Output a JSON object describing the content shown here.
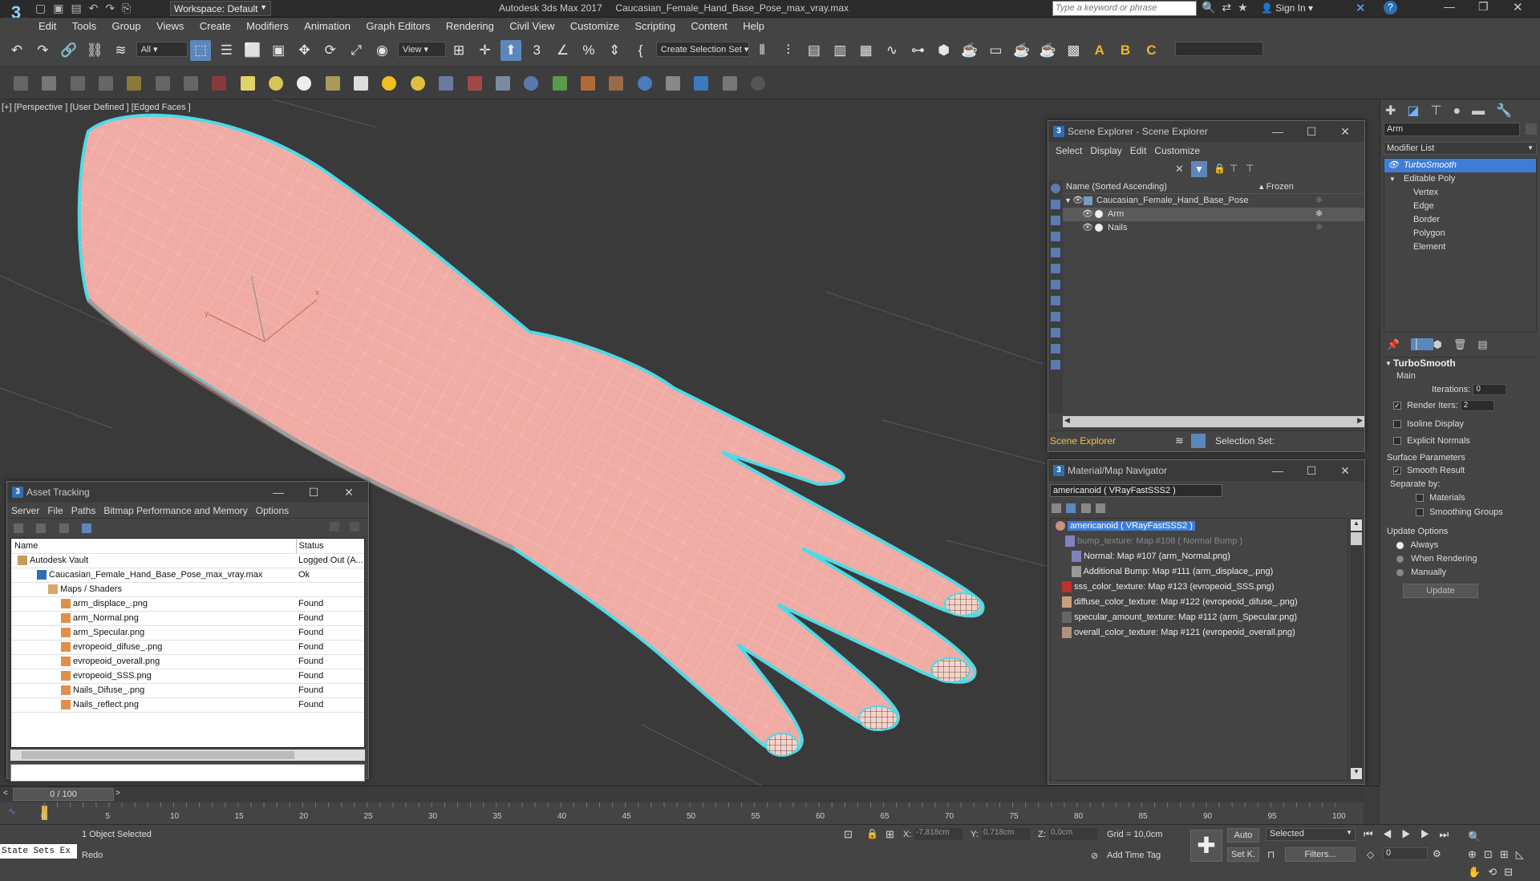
{
  "titlebar": {
    "workspace_label": "Workspace: Default",
    "app_title": "Autodesk 3ds Max 2017",
    "file_title": "Caucasian_Female_Hand_Base_Pose_max_vray.max",
    "search_placeholder": "Type a keyword or phrase",
    "sign_in": "Sign In"
  },
  "menubar": [
    "Edit",
    "Tools",
    "Group",
    "Views",
    "Create",
    "Modifiers",
    "Animation",
    "Graph Editors",
    "Rendering",
    "Civil View",
    "Customize",
    "Scripting",
    "Content",
    "Help"
  ],
  "toolbar": {
    "filter_value": "All",
    "refcoord_value": "View",
    "selection_set": "Create Selection Set"
  },
  "viewport": {
    "label_plus": "[+]",
    "label_view": "[Perspective ]",
    "label_shading": "[User Defined ]",
    "label_edges": "[Edged Faces ]",
    "gizmo_x": "x",
    "gizmo_y": "y",
    "gizmo_z": "z"
  },
  "asset_tracking": {
    "title": "Asset Tracking",
    "menu": [
      "Server",
      "File",
      "Paths",
      "Bitmap Performance and Memory",
      "Options"
    ],
    "col_name": "Name",
    "col_status": "Status",
    "rows": [
      {
        "name": "Autodesk Vault",
        "status": "Logged Out (A...",
        "indent": 0
      },
      {
        "name": "Caucasian_Female_Hand_Base_Pose_max_vray.max",
        "status": "Ok",
        "indent": 1
      },
      {
        "name": "Maps / Shaders",
        "status": "",
        "indent": 2
      },
      {
        "name": "arm_displace_.png",
        "status": "Found",
        "indent": 3
      },
      {
        "name": "arm_Normal.png",
        "status": "Found",
        "indent": 3
      },
      {
        "name": "arm_Specular.png",
        "status": "Found",
        "indent": 3
      },
      {
        "name": "evropeoid_difuse_.png",
        "status": "Found",
        "indent": 3
      },
      {
        "name": "evropeoid_overall.png",
        "status": "Found",
        "indent": 3
      },
      {
        "name": "evropeoid_SSS.png",
        "status": "Found",
        "indent": 3
      },
      {
        "name": "Nails_Difuse_.png",
        "status": "Found",
        "indent": 3
      },
      {
        "name": "Nails_reflect.png",
        "status": "Found",
        "indent": 3
      }
    ]
  },
  "scene_explorer": {
    "title": "Scene Explorer - Scene Explorer",
    "menu": [
      "Select",
      "Display",
      "Edit",
      "Customize"
    ],
    "col_name": "Name (Sorted Ascending)",
    "col_frozen": "▴ Frozen",
    "items": [
      {
        "name": "Caucasian_Female_Hand_Base_Pose",
        "level": 0,
        "selected": false
      },
      {
        "name": "Arm",
        "level": 1,
        "selected": true
      },
      {
        "name": "Nails",
        "level": 1,
        "selected": false
      }
    ],
    "footer_tab": "Scene Explorer",
    "selection_set_label": "Selection Set:"
  },
  "material_navigator": {
    "title": "Material/Map Navigator",
    "current": "americanoid  ( VRayFastSSS2 )",
    "items": [
      {
        "text": "americanoid  ( VRayFastSSS2 )",
        "level": 0,
        "selected": true,
        "dim": false
      },
      {
        "text": "bump_texture: Map #108  ( Normal Bump )",
        "level": 1,
        "selected": false,
        "dim": true
      },
      {
        "text": "Normal: Map #107 (arm_Normal.png)",
        "level": 2,
        "selected": false,
        "dim": false
      },
      {
        "text": "Additional Bump: Map #111 (arm_displace_.png)",
        "level": 2,
        "selected": false,
        "dim": false
      },
      {
        "text": "sss_color_texture: Map #123 (evropeoid_SSS.png)",
        "level": 1,
        "selected": false,
        "dim": false
      },
      {
        "text": "diffuse_color_texture: Map #122 (evropeoid_difuse_.png)",
        "level": 1,
        "selected": false,
        "dim": false
      },
      {
        "text": "specular_amount_texture: Map #112 (arm_Specular.png)",
        "level": 1,
        "selected": false,
        "dim": false
      },
      {
        "text": "overall_color_texture: Map #121 (evropeoid_overall.png)",
        "level": 1,
        "selected": false,
        "dim": false
      }
    ]
  },
  "command_panel": {
    "object_name": "Arm",
    "modifier_list": "Modifier List",
    "stack": [
      {
        "label": "TurboSmooth",
        "level": 0,
        "selected": true
      },
      {
        "label": "Editable Poly",
        "level": 0,
        "selected": false
      },
      {
        "label": "Vertex",
        "level": 1,
        "selected": false
      },
      {
        "label": "Edge",
        "level": 1,
        "selected": false
      },
      {
        "label": "Border",
        "level": 1,
        "selected": false
      },
      {
        "label": "Polygon",
        "level": 1,
        "selected": false
      },
      {
        "label": "Element",
        "level": 1,
        "selected": false
      }
    ],
    "rollout_title": "TurboSmooth",
    "main_label": "Main",
    "iterations_label": "Iterations:",
    "iterations_value": "0",
    "render_iters_label": "Render Iters:",
    "render_iters_value": "2",
    "isoline_label": "Isoline Display",
    "explicit_normals_label": "Explicit Normals",
    "surface_params_label": "Surface Parameters",
    "smooth_result_label": "Smooth Result",
    "separate_by_label": "Separate by:",
    "materials_label": "Materials",
    "smoothing_groups_label": "Smoothing Groups",
    "update_options_label": "Update Options",
    "always_label": "Always",
    "when_rendering_label": "When Rendering",
    "manually_label": "Manually",
    "update_button": "Update"
  },
  "timeline": {
    "frame_label": "0 / 100",
    "ticks": [
      "0",
      "5",
      "10",
      "15",
      "20",
      "25",
      "30",
      "35",
      "40",
      "45",
      "50",
      "55",
      "60",
      "65",
      "70",
      "75",
      "80",
      "85",
      "90",
      "95",
      "100"
    ]
  },
  "status": {
    "state_sets": "State Sets Ex",
    "selected_count": "1 Object Selected",
    "prompt": "Redo",
    "x_label": "X:",
    "x_value": "-7,818cm",
    "y_label": "Y:",
    "y_value": "0,718cm",
    "z_label": "Z:",
    "z_value": "0,0cm",
    "grid": "Grid = 10,0cm",
    "add_time_tag": "Add Time Tag",
    "auto": "Auto",
    "set_k": "Set K.",
    "selected_dd": "Selected",
    "filters": "Filters...",
    "frame_value": "0"
  },
  "colors": {
    "accent": "#5c87bc",
    "selection_outline": "#4fd9e6",
    "skin": "#f0aca4"
  }
}
